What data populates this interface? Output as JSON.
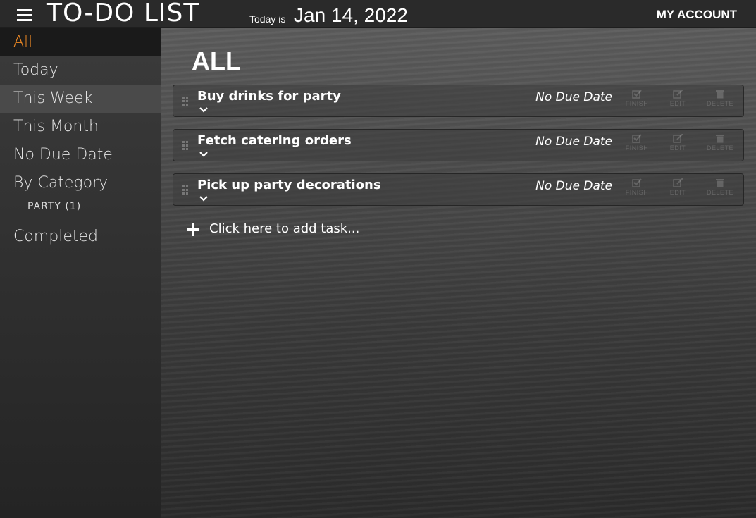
{
  "header": {
    "title": "TO-DO LIST",
    "today_label": "Today is",
    "today_date": "Jan 14, 2022",
    "account": "MY ACCOUNT"
  },
  "sidebar": {
    "items": [
      {
        "label": "All"
      },
      {
        "label": "Today"
      },
      {
        "label": "This Week"
      },
      {
        "label": "This Month"
      },
      {
        "label": "No Due Date"
      },
      {
        "label": "By Category"
      }
    ],
    "categories": [
      {
        "label": "PARTY (1)"
      }
    ],
    "completed": "Completed"
  },
  "main": {
    "heading": "ALL",
    "tasks": [
      {
        "title": "Buy drinks for party",
        "due": "No Due Date"
      },
      {
        "title": "Fetch catering orders",
        "due": "No Due Date"
      },
      {
        "title": "Pick up party decorations",
        "due": "No Due Date"
      }
    ],
    "actions": {
      "finish": "FINISH",
      "edit": "EDIT",
      "delete": "DELETE"
    },
    "add_task": "Click here to add task..."
  },
  "colors": {
    "accent": "#f08a24",
    "header_bg": "#2a2a2a",
    "sidebar_bg": "#333333"
  }
}
